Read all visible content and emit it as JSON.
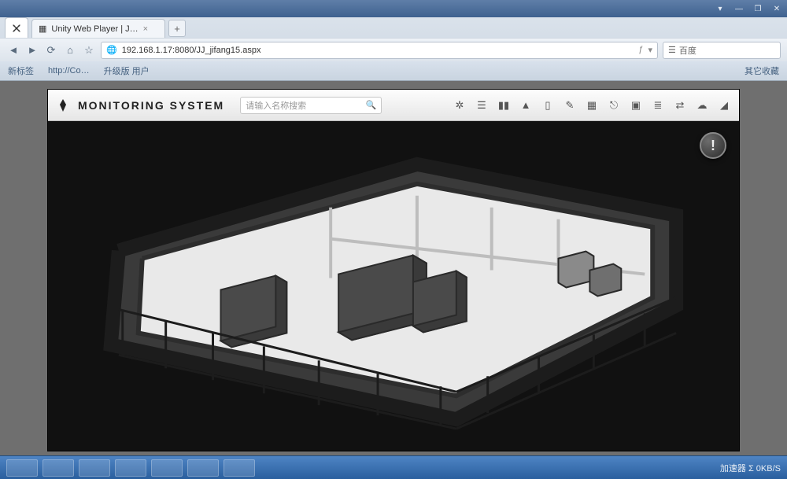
{
  "browser": {
    "tab_title": "Unity Web Player | J…",
    "url": "192.168.1.17:8080/JJ_jifang15.aspx",
    "search_engine_label": "百度",
    "window": {
      "min": "—",
      "max": "❐",
      "close": "✕",
      "menu": "▾"
    },
    "nav": {
      "back": "◄",
      "forward": "►",
      "reload": "⟳",
      "home": "⌂",
      "star": "☆"
    },
    "bookmarks": {
      "b1": "新标签",
      "b2": "http://Co…",
      "b3": "升级版 用户",
      "right": "其它收藏"
    }
  },
  "app": {
    "title": "MONITORING SYSTEM",
    "search_placeholder": "请输入名称搜索",
    "info_label": "!",
    "toolbar_tips": {
      "gear": "settings",
      "list": "list",
      "chart": "chart",
      "alert": "alert",
      "battery": "battery",
      "edit": "edit",
      "grid": "grid",
      "power": "power",
      "expand": "expand",
      "menu": "menu",
      "swap": "swap",
      "cloud": "cloud",
      "signal": "signal"
    }
  },
  "taskbar": {
    "tray_text": "加速器  Σ 0KB/S"
  }
}
